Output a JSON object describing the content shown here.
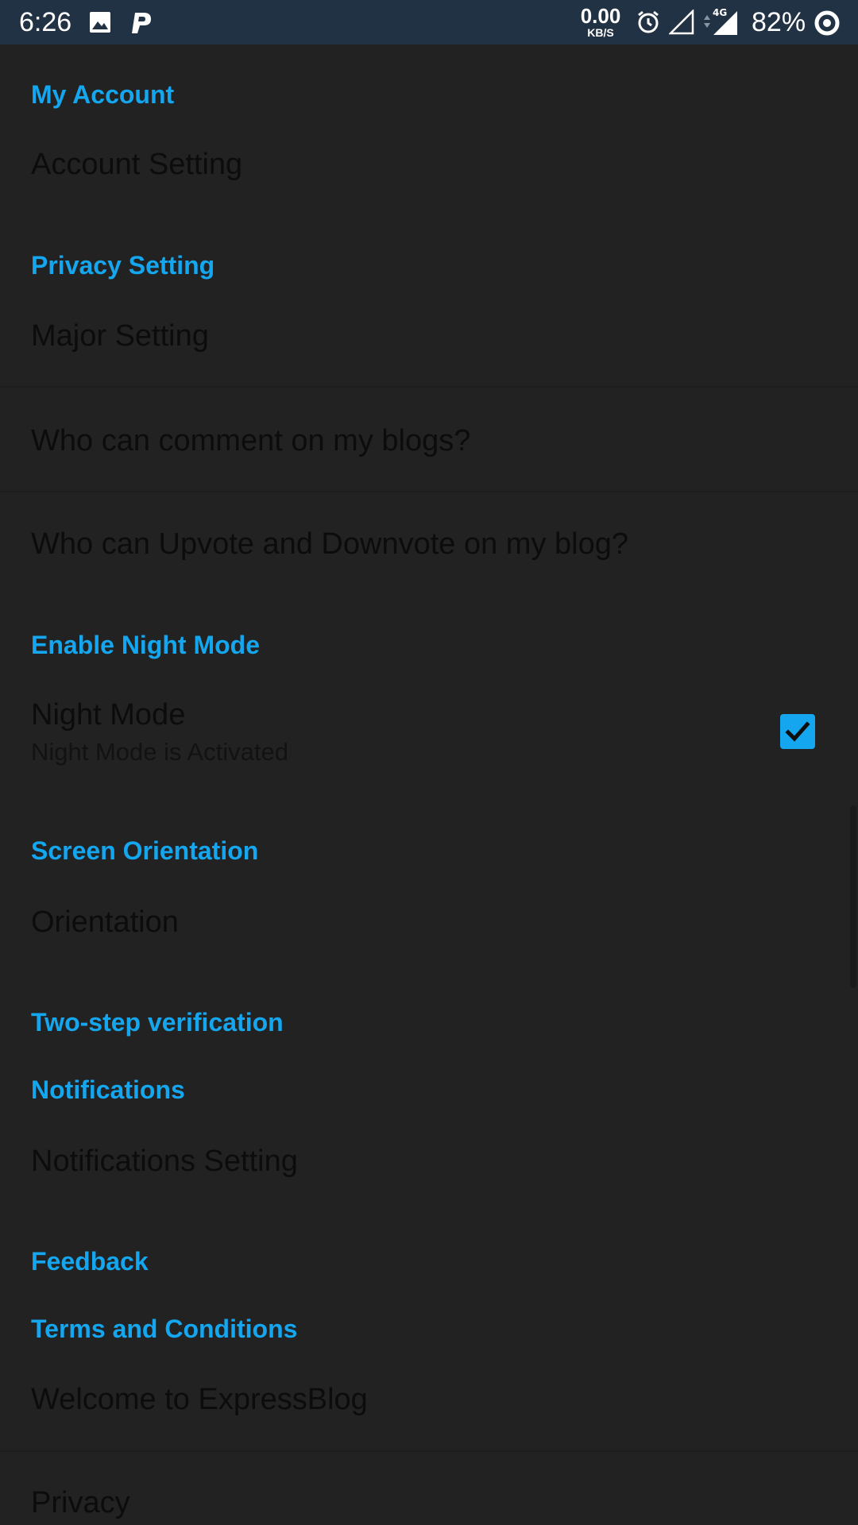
{
  "status_bar": {
    "time": "6:26",
    "net_speed_value": "0.00",
    "net_speed_unit": "KB/S",
    "network_type": "4G",
    "battery": "82%",
    "icons": [
      "image-icon",
      "p-app-icon",
      "alarm-icon",
      "signal-empty-icon",
      "signal-4g-icon",
      "battery-ring-icon"
    ]
  },
  "settings": {
    "my_account": {
      "header": "My Account",
      "account_setting": "Account Setting"
    },
    "privacy": {
      "header": "Privacy Setting",
      "major_setting": "Major Setting",
      "comment": "Who can comment on my blogs?",
      "vote": "Who can Upvote and Downvote on my blog?"
    },
    "night_mode": {
      "header": "Enable Night Mode",
      "title": "Night Mode",
      "summary": "Night Mode is Activated",
      "checked": true
    },
    "orientation": {
      "header": "Screen Orientation",
      "title": "Orientation"
    },
    "two_step": {
      "header": "Two-step verification"
    },
    "notifications": {
      "header": "Notifications",
      "title": "Notifications Setting"
    },
    "feedback": {
      "header": "Feedback"
    },
    "terms": {
      "header": "Terms and Conditions",
      "welcome": "Welcome to ExpressBlog",
      "privacy": "Privacy"
    }
  },
  "colors": {
    "accent": "#14a6ef",
    "background": "#222222",
    "status_bar": "#223245"
  }
}
